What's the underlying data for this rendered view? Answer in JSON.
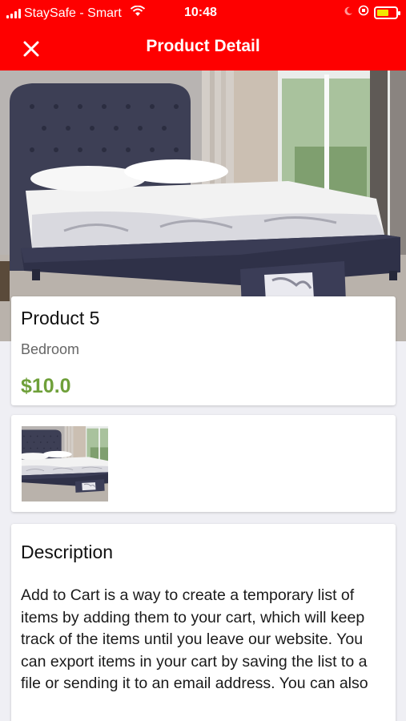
{
  "status_bar": {
    "carrier": "StaySafe - Smart",
    "time": "10:48",
    "battery_charging": true
  },
  "header": {
    "title": "Product Detail",
    "close_icon": "close-icon",
    "background_color": "#fe0000"
  },
  "product": {
    "name": "Product 5",
    "category": "Bedroom",
    "price": "$10.0",
    "price_color": "#6fa03a",
    "image": "bed-photo"
  },
  "gallery": {
    "thumbnails": [
      "bed-photo"
    ]
  },
  "description": {
    "title": "Description",
    "body": "Add to Cart is a way to create a temporary list of items by adding them to your cart, which will keep track of the items until you leave our website. You can export items in your cart by saving the list to a file or sending it to an email address. You can also"
  }
}
